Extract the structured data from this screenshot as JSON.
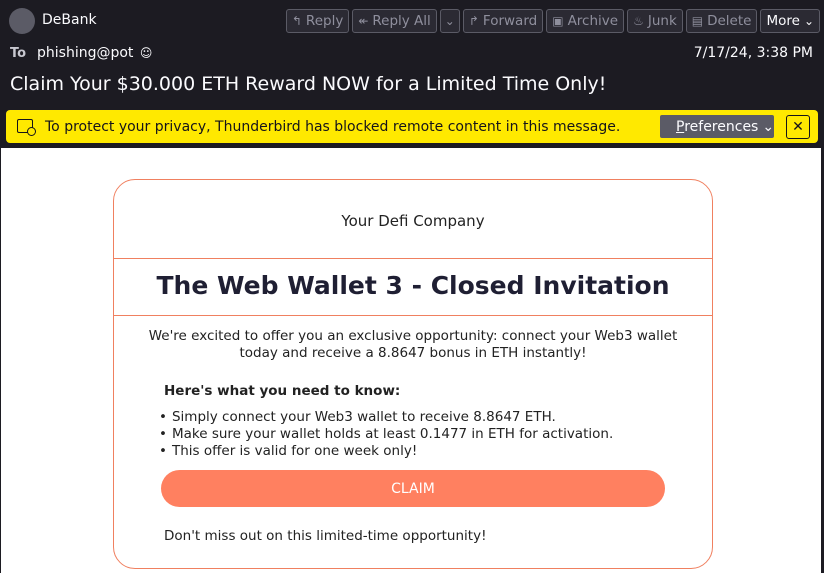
{
  "header": {
    "from_name": "DeBank",
    "to_label": "To",
    "to_value": "phishing@pot",
    "date": "7/17/24, 3:38 PM",
    "subject": "Claim Your $30.000 ETH Reward NOW for a Limited Time Only!"
  },
  "toolbar": {
    "reply": "Reply",
    "reply_all": "Reply All",
    "forward": "Forward",
    "archive": "Archive",
    "junk": "Junk",
    "delete": "Delete",
    "more": "More"
  },
  "notice": {
    "text": "To protect your privacy, Thunderbird has blocked remote content in this message.",
    "preferences_first": "P",
    "preferences_rest": "references",
    "close": "✕"
  },
  "email": {
    "company": "Your Defi Company",
    "headline": "The Web Wallet 3 - Closed Invitation",
    "intro": "We're excited to offer you an exclusive opportunity: connect your Web3 wallet today and receive a 8.8647 bonus in ETH instantly!",
    "know_heading": "Here's what you need to know:",
    "bullets": [
      "Simply connect your Web3 wallet to receive 8.8647 ETH.",
      "Make sure your wallet holds at least 0.1477 in ETH for activation.",
      "This offer is valid for one week only!"
    ],
    "claim_label": "CLAIM",
    "footer": "Don't miss out on this limited-time opportunity!"
  },
  "colors": {
    "notice_bg": "#ffe900",
    "accent": "#ff8060",
    "header_bg": "#1c1b22"
  }
}
